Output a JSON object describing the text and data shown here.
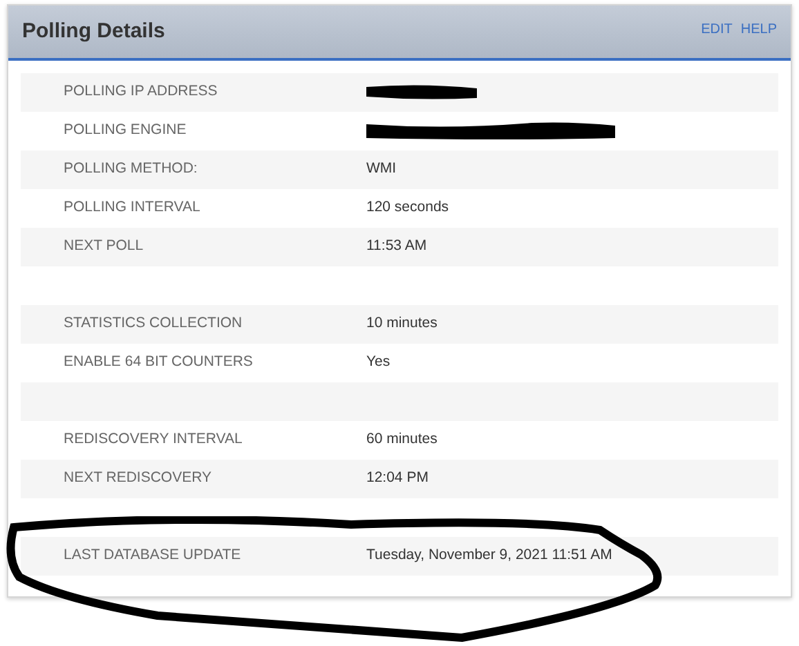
{
  "panel": {
    "title": "Polling Details",
    "links": [
      "EDIT",
      "HELP"
    ]
  },
  "rows": [
    {
      "kind": "pair",
      "label": "POLLING IP ADDRESS",
      "redacted": true
    },
    {
      "kind": "pair",
      "label": "POLLING ENGINE",
      "redacted": true
    },
    {
      "kind": "pair",
      "label": "POLLING METHOD:",
      "value": "WMI",
      "redacted": false
    },
    {
      "kind": "pair",
      "label": "POLLING INTERVAL",
      "value": "120 seconds",
      "redacted": false
    },
    {
      "kind": "pair",
      "label": "NEXT POLL",
      "value": "11:53 AM",
      "redacted": false
    },
    {
      "kind": "spacer"
    },
    {
      "kind": "pair",
      "label": "STATISTICS COLLECTION",
      "value": "10 minutes",
      "redacted": false
    },
    {
      "kind": "pair",
      "label": "ENABLE 64 BIT COUNTERS",
      "value": "Yes",
      "redacted": false
    },
    {
      "kind": "spacer"
    },
    {
      "kind": "pair",
      "label": "REDISCOVERY INTERVAL",
      "value": "60 minutes",
      "redacted": false
    },
    {
      "kind": "pair",
      "label": "NEXT REDISCOVERY",
      "value": "12:04 PM",
      "redacted": false
    },
    {
      "kind": "spacer"
    },
    {
      "kind": "pair",
      "label": "LAST DATABASE UPDATE",
      "value": "Tuesday, November 9, 2021 11:51 AM",
      "redacted": false
    }
  ]
}
